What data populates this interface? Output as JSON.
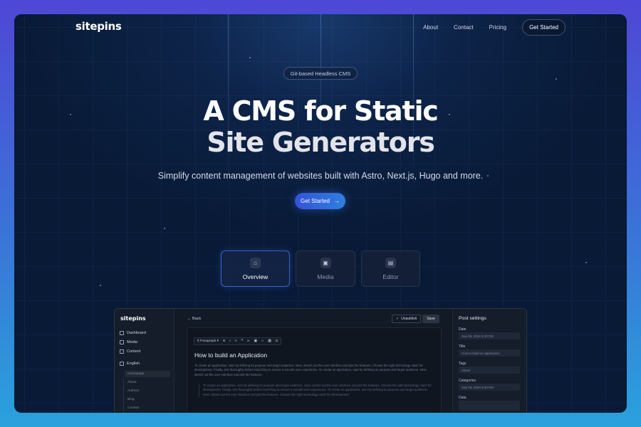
{
  "nav": {
    "logo": "sitepins",
    "links": [
      "About",
      "Contact",
      "Pricing"
    ],
    "cta": "Get Started"
  },
  "hero": {
    "badge": "Git-based Headless CMS",
    "title_line1": "A CMS for Static",
    "title_line2": "Site Generators",
    "subtitle": "Simplify content management of websites built with Astro, Next.js, Hugo and more.",
    "cta": "Get Started"
  },
  "tabs": [
    {
      "label": "Overview",
      "icon": "home-icon",
      "active": true
    },
    {
      "label": "Media",
      "icon": "images-icon",
      "active": false
    },
    {
      "label": "Editor",
      "icon": "document-icon",
      "active": false
    }
  ],
  "app": {
    "logo": "sitepins",
    "menu": [
      "Dashboard",
      "Media",
      "Content"
    ],
    "language": "English",
    "pages": [
      "Homepage",
      "About",
      "Authors",
      "Blog",
      "Contact"
    ],
    "back": "Back",
    "unpublish": "Unpublish",
    "save": "Save",
    "toolbar_style": "Paragraph",
    "post_title": "How to build an Application",
    "post_body": "To create an application, start by defining its purpose and target audience. Next, sketch out the user interface and plot the features. Choose the right technology stack for development. Finally, test thoroughly before launching to ensure a smooth user experience. To create an application, start by defining its purpose and target audience. Next, sketch out the user interface and plot the features.",
    "post_quote": "To create an application, start by defining its purpose and target audience. Next, sketch out the user interface and plot the features. Choose the right technology stack for development. Finally, test thoroughly before launching to ensure a smooth user experience. To create an application, start by defining its purpose and target audience. Next, sketch out the user interface and plot the features. Choose the right technology stack for development.",
    "settings": {
      "heading": "Post settings",
      "date_label": "Date",
      "date_value": "Sep 09, 2024 5:30 PM",
      "title_label": "Title",
      "title_value": "How to build an application",
      "tags_label": "Tags",
      "tags_value": "About",
      "categories_label": "Categories",
      "categories_value": "Sep 09, 2024 5:30 PM",
      "data_label": "Data"
    }
  },
  "colors": {
    "page_gradient_top": "#4f47d6",
    "page_gradient_bottom": "#29a2dc",
    "hero_bg": "#0d2348",
    "button_blue": "#3452d8",
    "active_tab_border": "#3f62c9"
  }
}
